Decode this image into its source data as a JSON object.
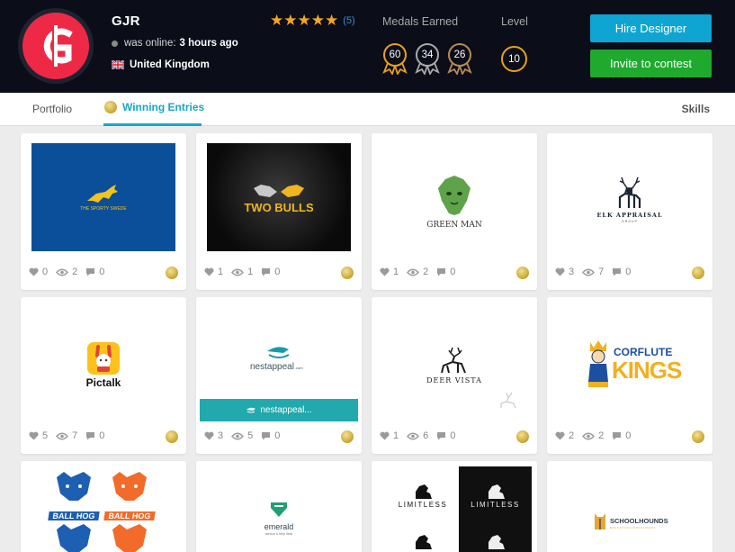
{
  "profile": {
    "username": "GJR",
    "online_label": "was online:",
    "online_value": "3 hours ago",
    "country": "United Kingdom",
    "rating_count": "(5)",
    "stars": 5
  },
  "medals": {
    "label": "Medals Earned",
    "gold": "60",
    "silver": "34",
    "bronze": "26"
  },
  "level": {
    "label": "Level",
    "value": "10"
  },
  "buttons": {
    "hire": "Hire Designer",
    "invite": "Invite to contest"
  },
  "tabs": {
    "portfolio": "Portfolio",
    "winning": "Winning Entries",
    "skills": "Skills"
  },
  "colors": {
    "accent": "#17a7c7",
    "hire": "#0fa5d2",
    "invite": "#1faa2f",
    "medal_gold": "#e6a11a"
  },
  "cards": [
    {
      "likes": "0",
      "views": "2",
      "comments": "0",
      "logo": "THE SPORTY SWEDE"
    },
    {
      "likes": "1",
      "views": "1",
      "comments": "0",
      "logo": "TWO BULLS"
    },
    {
      "likes": "1",
      "views": "2",
      "comments": "0",
      "logo": "GREEN MAN"
    },
    {
      "likes": "3",
      "views": "7",
      "comments": "0",
      "logo": "ELK APPRAISAL",
      "logo_sub": "GROUP"
    },
    {
      "likes": "5",
      "views": "7",
      "comments": "0",
      "logo": "Pictalk"
    },
    {
      "likes": "3",
      "views": "5",
      "comments": "0",
      "logo": "nestappeal",
      "logo_suffix": ".com",
      "hover": "nestappeal..."
    },
    {
      "likes": "1",
      "views": "6",
      "comments": "0",
      "logo": "DEER VISTA"
    },
    {
      "likes": "2",
      "views": "2",
      "comments": "0",
      "logo": "CORFLUTE",
      "logo_second": "KINGS"
    },
    {
      "logo": "BALL HOG"
    },
    {
      "logo": "emerald",
      "logo_sub": "service & help desk"
    },
    {
      "logo": "LIMITLESS"
    },
    {
      "logo": "SCHOOLHOUNDS",
      "logo_sub": "EDUCATION CONSULTANCY"
    }
  ]
}
